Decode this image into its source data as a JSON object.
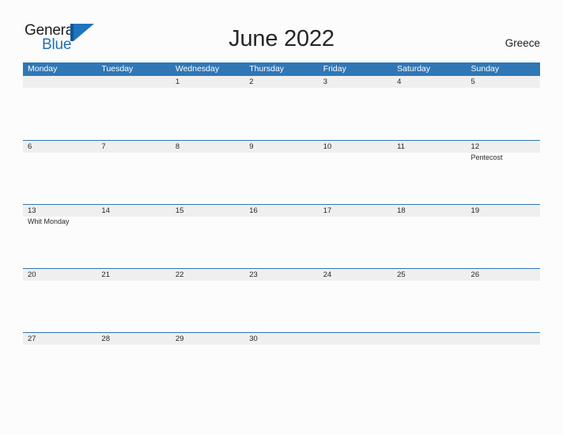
{
  "brand": {
    "word_one": "General",
    "word_two": "Blue",
    "mark": "triangle-logo"
  },
  "header": {
    "title": "June 2022",
    "country": "Greece"
  },
  "colors": {
    "header_blue": "#2f77b6",
    "band_gray": "#efefef",
    "brand_blue": "#1f6fb5",
    "page_background": "#fcfcfc"
  },
  "calendar": {
    "weekdays": [
      "Monday",
      "Tuesday",
      "Wednesday",
      "Thursday",
      "Friday",
      "Saturday",
      "Sunday"
    ],
    "weeks": [
      [
        {
          "day": "",
          "events": []
        },
        {
          "day": "",
          "events": []
        },
        {
          "day": "1",
          "events": []
        },
        {
          "day": "2",
          "events": []
        },
        {
          "day": "3",
          "events": []
        },
        {
          "day": "4",
          "events": []
        },
        {
          "day": "5",
          "events": []
        }
      ],
      [
        {
          "day": "6",
          "events": []
        },
        {
          "day": "7",
          "events": []
        },
        {
          "day": "8",
          "events": []
        },
        {
          "day": "9",
          "events": []
        },
        {
          "day": "10",
          "events": []
        },
        {
          "day": "11",
          "events": []
        },
        {
          "day": "12",
          "events": [
            "Pentecost"
          ]
        }
      ],
      [
        {
          "day": "13",
          "events": [
            "Whit Monday"
          ]
        },
        {
          "day": "14",
          "events": []
        },
        {
          "day": "15",
          "events": []
        },
        {
          "day": "16",
          "events": []
        },
        {
          "day": "17",
          "events": []
        },
        {
          "day": "18",
          "events": []
        },
        {
          "day": "19",
          "events": []
        }
      ],
      [
        {
          "day": "20",
          "events": []
        },
        {
          "day": "21",
          "events": []
        },
        {
          "day": "22",
          "events": []
        },
        {
          "day": "23",
          "events": []
        },
        {
          "day": "24",
          "events": []
        },
        {
          "day": "25",
          "events": []
        },
        {
          "day": "26",
          "events": []
        }
      ],
      [
        {
          "day": "27",
          "events": []
        },
        {
          "day": "28",
          "events": []
        },
        {
          "day": "29",
          "events": []
        },
        {
          "day": "30",
          "events": []
        },
        {
          "day": "",
          "events": []
        },
        {
          "day": "",
          "events": []
        },
        {
          "day": "",
          "events": []
        }
      ]
    ]
  }
}
